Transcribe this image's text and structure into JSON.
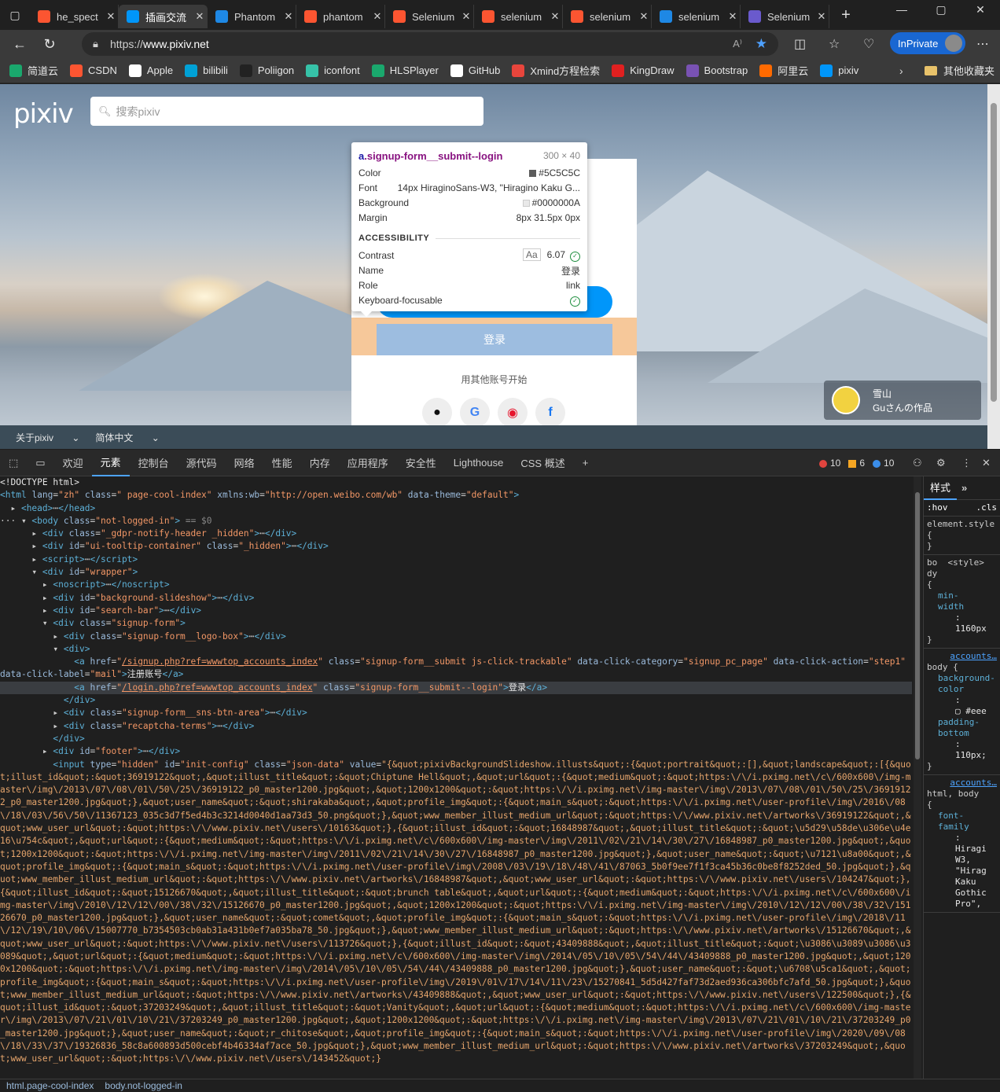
{
  "browser": {
    "tabs": [
      {
        "title": "he_spect",
        "icon": "csdn-icon",
        "color": "#fc5531"
      },
      {
        "title": "插画交流",
        "icon": "pixiv-icon",
        "color": "#0096fa",
        "active": true
      },
      {
        "title": "Phantom",
        "icon": "search-icon",
        "color": "#1e88e5"
      },
      {
        "title": "phantom",
        "icon": "csdn-icon",
        "color": "#fc5531"
      },
      {
        "title": "Selenium",
        "icon": "csdn-icon",
        "color": "#fc5531"
      },
      {
        "title": "selenium",
        "icon": "csdn-icon",
        "color": "#fc5531"
      },
      {
        "title": "selenium",
        "icon": "csdn-icon",
        "color": "#fc5531"
      },
      {
        "title": "selenium",
        "icon": "search-icon",
        "color": "#1e88e5"
      },
      {
        "title": "Selenium",
        "icon": "selenium-icon",
        "color": "#6a5acd"
      }
    ],
    "url_prefix": "https://",
    "url_domain": "www.pixiv.net",
    "inprivate_label": "InPrivate",
    "bookmarks": [
      {
        "label": "简道云",
        "color": "#1aa86d"
      },
      {
        "label": "CSDN",
        "color": "#fc5531"
      },
      {
        "label": "Apple",
        "color": "#ffffff"
      },
      {
        "label": "bilibili",
        "color": "#00a1d6"
      },
      {
        "label": "Poliigon",
        "color": "#222222"
      },
      {
        "label": "iconfont",
        "color": "#36c2a8"
      },
      {
        "label": "HLSPlayer",
        "color": "#1aa86d"
      },
      {
        "label": "GitHub",
        "color": "#ffffff"
      },
      {
        "label": "Xmind方程检索",
        "color": "#e8453c"
      },
      {
        "label": "KingDraw",
        "color": "#e02020"
      },
      {
        "label": "Bootstrap",
        "color": "#7952b3"
      },
      {
        "label": "阿里云",
        "color": "#ff6a00"
      },
      {
        "label": "pixiv",
        "color": "#0096fa"
      }
    ],
    "other_bookmarks": "其他收藏夹"
  },
  "page": {
    "logo": "pixiv",
    "search_placeholder": "搜索pixiv",
    "login_button": "登录",
    "other_accounts": "用其他账号开始",
    "sns": [
      {
        "name": "apple",
        "glyph": ""
      },
      {
        "name": "google",
        "glyph": "G"
      },
      {
        "name": "weibo",
        "glyph": "微"
      },
      {
        "name": "facebook",
        "glyph": "f"
      }
    ],
    "artwork_title": "雪山",
    "artwork_author": "Guさんの作品",
    "footer_about": "关于pixiv",
    "footer_lang": "简体中文"
  },
  "tooltip": {
    "selector_tag": "a",
    "selector_class": ".signup-form__submit--login",
    "size": "300 × 40",
    "rows": [
      {
        "label": "Color",
        "value": "#5C5C5C",
        "swatch": "#5c5c5c"
      },
      {
        "label": "Font",
        "value": "14px HiraginoSans-W3, \"Hiragino Kaku G..."
      },
      {
        "label": "Background",
        "value": "#0000000A",
        "swatch": "#e9e9e9"
      },
      {
        "label": "Margin",
        "value": "8px 31.5px 0px"
      }
    ],
    "accessibility_title": "ACCESSIBILITY",
    "a11y": [
      {
        "label": "Contrast",
        "value": "6.07",
        "aa": "Aa",
        "ok": true
      },
      {
        "label": "Name",
        "value": "登录"
      },
      {
        "label": "Role",
        "value": "link"
      },
      {
        "label": "Keyboard-focusable",
        "value": "",
        "ok": true
      }
    ]
  },
  "devtools": {
    "tabs": [
      "欢迎",
      "元素",
      "控制台",
      "源代码",
      "网络",
      "性能",
      "内存",
      "应用程序",
      "安全性",
      "Lighthouse",
      "CSS 概述"
    ],
    "active_tab": "元素",
    "errors": "10",
    "warnings": "6",
    "infos": "10",
    "styles_tab": "样式",
    "hov": ":hov",
    "cls": ".cls",
    "breadcrumb": [
      "html.page-cool-index",
      "body.not-logged-in"
    ]
  }
}
